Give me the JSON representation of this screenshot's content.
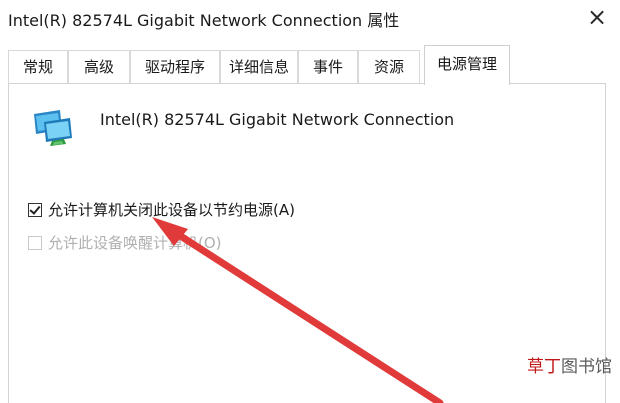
{
  "window": {
    "title": "Intel(R) 82574L Gigabit Network Connection 属性",
    "close_glyph": "×"
  },
  "tabs": [
    {
      "label": "常规"
    },
    {
      "label": "高级"
    },
    {
      "label": "驱动程序"
    },
    {
      "label": "详细信息"
    },
    {
      "label": "事件"
    },
    {
      "label": "资源"
    },
    {
      "label": "电源管理",
      "active": true
    }
  ],
  "panel": {
    "device_icon": "network-adapter-icon",
    "device_name": "Intel(R) 82574L Gigabit Network Connection",
    "options": [
      {
        "label": "允许计算机关闭此设备以节约电源(A)",
        "checked": true,
        "enabled": true
      },
      {
        "label": "允许此设备唤醒计算机(O)",
        "checked": false,
        "enabled": false
      }
    ]
  },
  "annotation": {
    "color": "#e03a3a"
  },
  "watermark": {
    "accent": "草丁",
    "rest": "图书馆"
  }
}
